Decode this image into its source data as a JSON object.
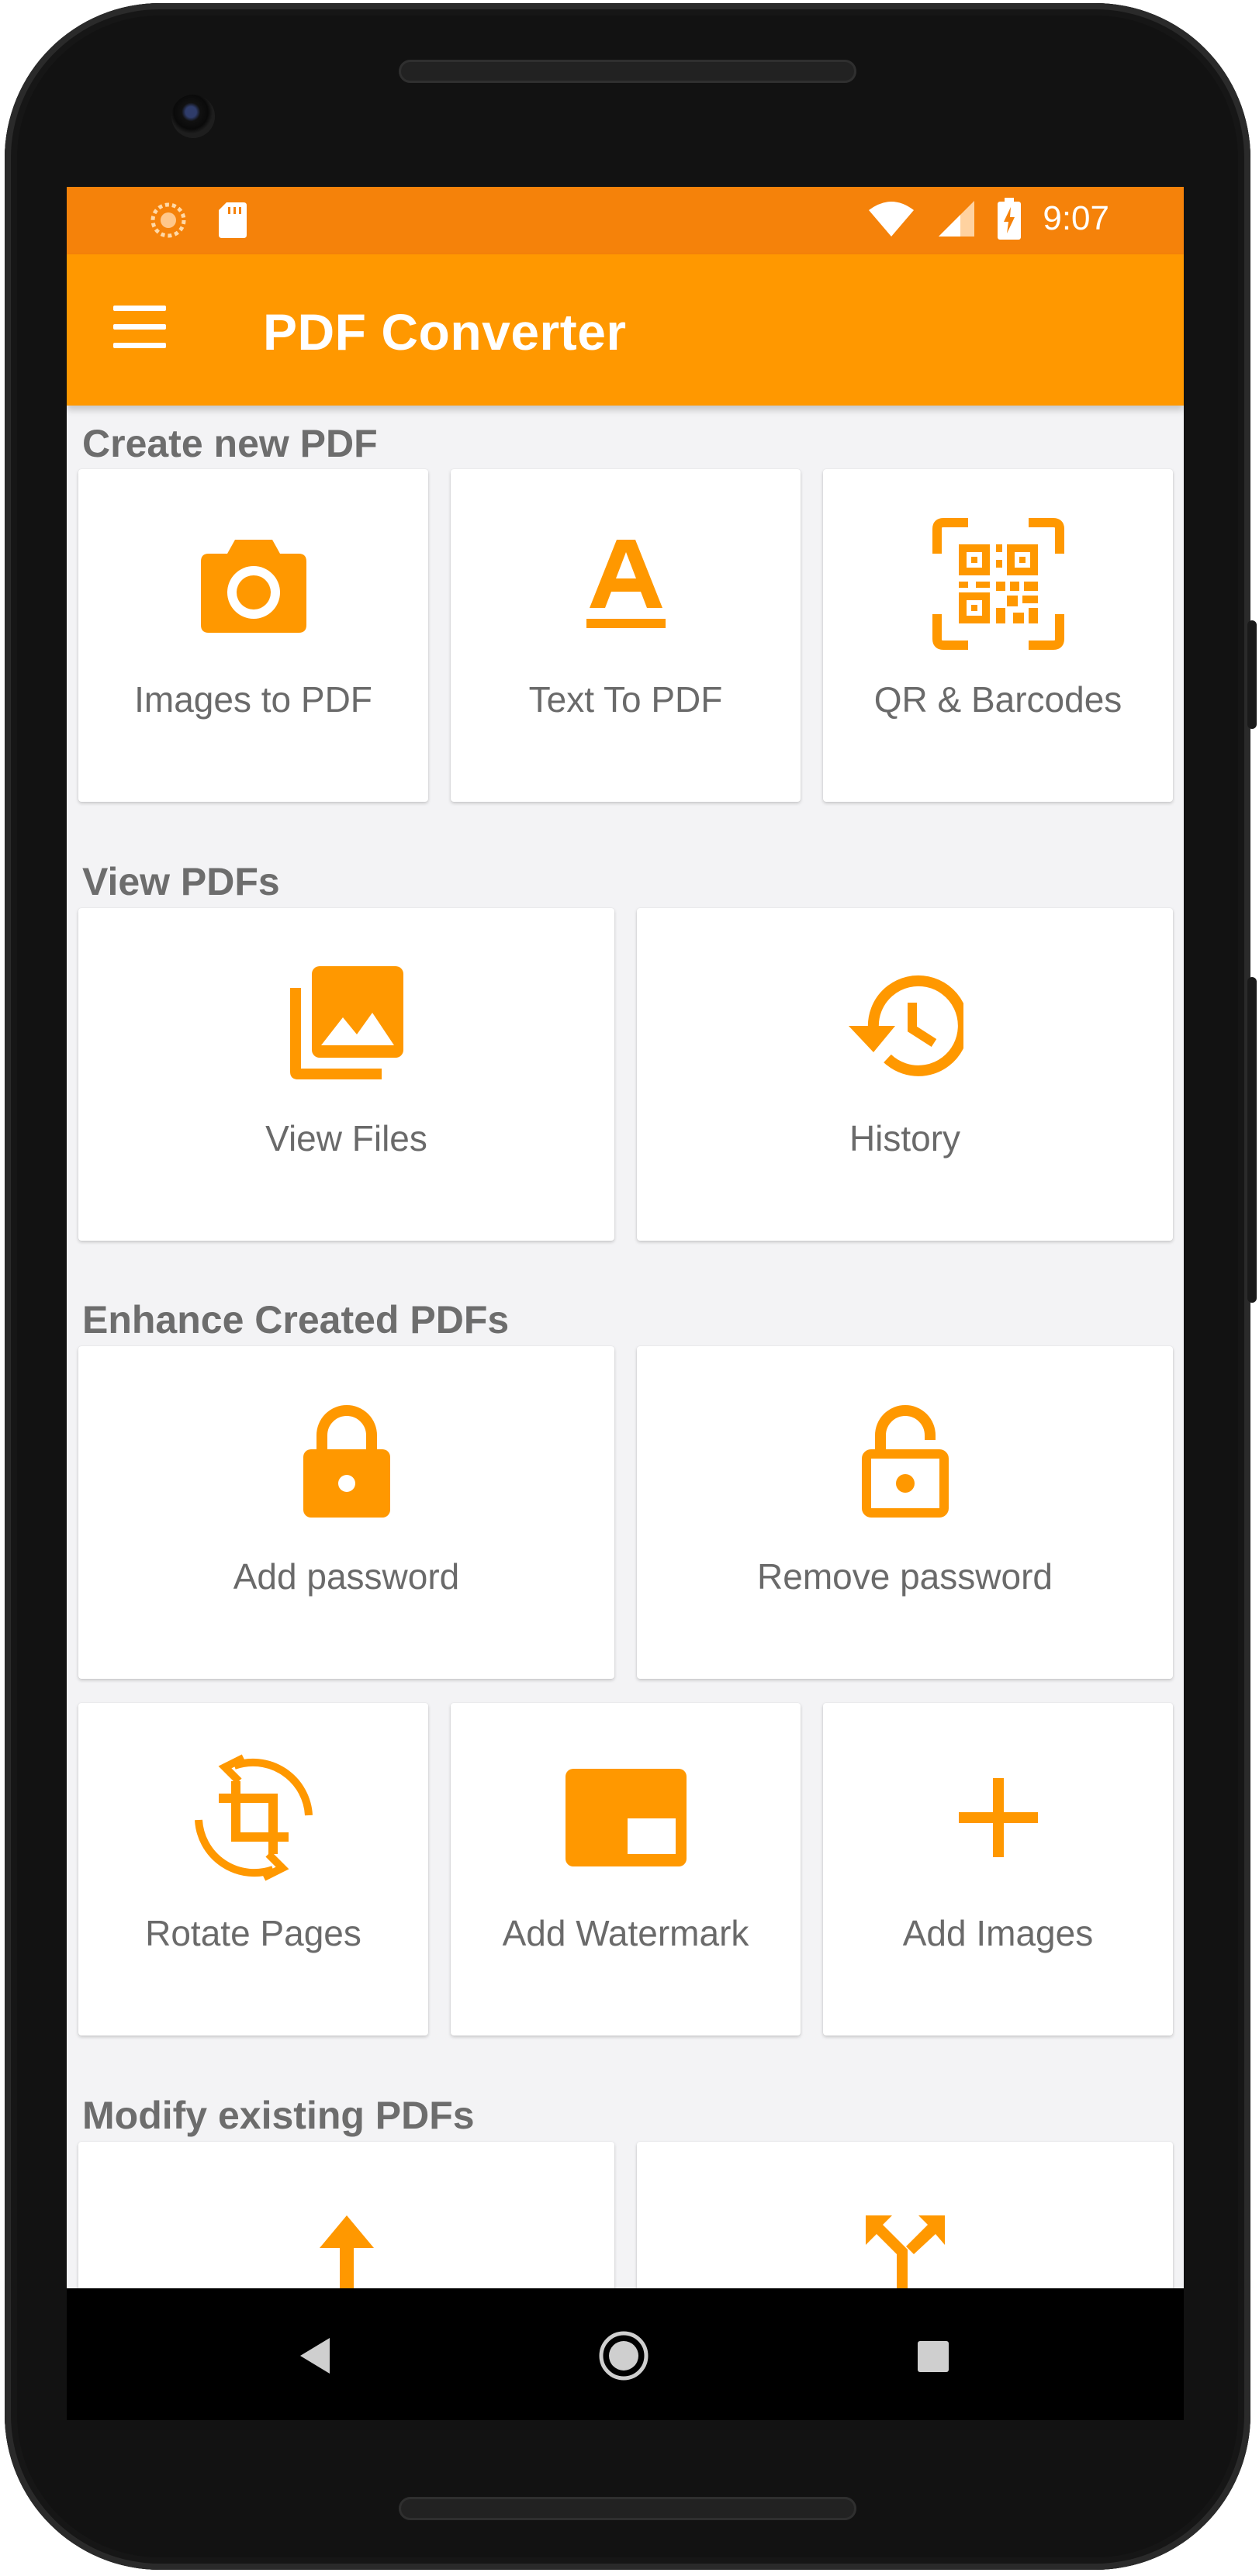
{
  "status_bar": {
    "time": "9:07",
    "left_icons": [
      "loading-icon",
      "sd-card-icon"
    ],
    "right_icons": [
      "wifi-icon",
      "signal-icon",
      "battery-charging-icon"
    ]
  },
  "app_bar": {
    "title": "PDF Converter",
    "menu_icon": "hamburger-menu-icon"
  },
  "sections": {
    "create": {
      "title": "Create new PDF",
      "items": [
        {
          "label": "Images to PDF",
          "icon": "camera-icon"
        },
        {
          "label": "Text To PDF",
          "icon": "text-format-icon"
        },
        {
          "label": "QR & Barcodes",
          "icon": "qr-code-scan-icon"
        }
      ]
    },
    "view": {
      "title": "View PDFs",
      "items": [
        {
          "label": "View Files",
          "icon": "photo-library-icon"
        },
        {
          "label": "History",
          "icon": "history-icon"
        }
      ]
    },
    "enhance": {
      "title": "Enhance Created PDFs",
      "items": [
        {
          "label": "Add password",
          "icon": "lock-icon"
        },
        {
          "label": "Remove password",
          "icon": "lock-open-icon"
        },
        {
          "label": "Rotate Pages",
          "icon": "crop-rotate-icon"
        },
        {
          "label": "Add Watermark",
          "icon": "watermark-icon"
        },
        {
          "label": "Add Images",
          "icon": "plus-icon"
        }
      ]
    },
    "modify": {
      "title": "Modify existing PDFs",
      "items": [
        {
          "label": "",
          "icon": "upload-arrow-icon"
        },
        {
          "label": "",
          "icon": "split-arrows-icon"
        }
      ]
    }
  },
  "nav_bar": {
    "icons": [
      "back-triangle-icon",
      "home-circle-icon",
      "recents-square-icon"
    ]
  },
  "colors": {
    "accent": "#ff9800",
    "status_bar": "#f5820a",
    "background": "#f3f3f5",
    "card": "#ffffff",
    "section_text": "#6d6d6d",
    "label_text": "#6a6a6a"
  }
}
